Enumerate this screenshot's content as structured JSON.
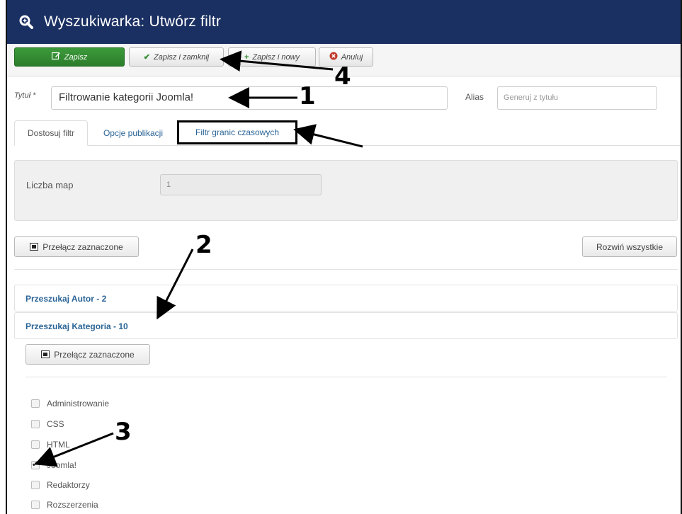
{
  "header": {
    "icon": "search-icon",
    "title": "Wyszukiwarka: Utwórz filtr",
    "bg_color": "#1b3062"
  },
  "toolbar": {
    "save_label": "Zapisz",
    "save_close_label": "Zapisz i zamknij",
    "save_new_label": "Zapisz i nowy",
    "cancel_label": "Anuluj",
    "save_color": "#2f8a2d"
  },
  "form": {
    "title_label": "Tytuł *",
    "title_value": "Filtrowanie kategorii Joomla!",
    "alias_label": "Alias",
    "alias_placeholder": "Generuj z tytułu"
  },
  "tabs": [
    {
      "label": "Dostosuj filtr",
      "active": true
    },
    {
      "label": "Opcje publikacji",
      "active": false
    },
    {
      "label": "Filtr granic czasowych",
      "active": false
    }
  ],
  "panel": {
    "maps_label": "Liczba map",
    "maps_value": "1"
  },
  "actions": {
    "toggle_selected": "Przełącz zaznaczone",
    "expand_all": "Rozwiń wszystkie"
  },
  "accordion": [
    {
      "label": "Przeszukaj Autor - 2"
    },
    {
      "label": "Przeszukaj Kategoria - 10"
    }
  ],
  "categories": [
    {
      "label": "Administrowanie",
      "checked": false
    },
    {
      "label": "CSS",
      "checked": false
    },
    {
      "label": "HTML",
      "checked": false
    },
    {
      "label": "Joomla!",
      "checked": true
    },
    {
      "label": "Redaktorzy",
      "checked": false
    },
    {
      "label": "Rozszerzenia",
      "checked": false
    }
  ],
  "annotations": {
    "n1": "1",
    "n2": "2",
    "n3": "3",
    "n4": "4"
  }
}
